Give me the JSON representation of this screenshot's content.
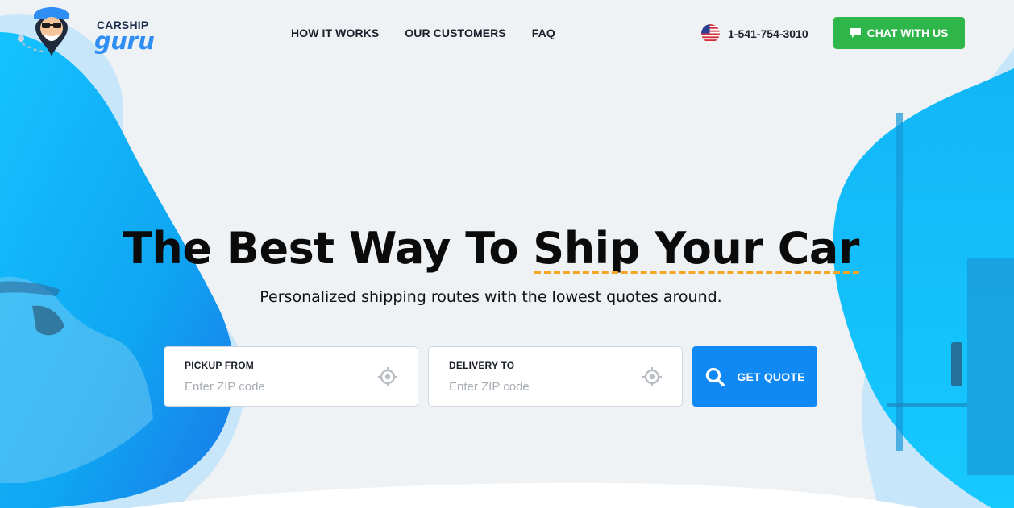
{
  "brand": {
    "name_top": "CARSHIP",
    "name_bottom": "guru"
  },
  "nav": {
    "items": [
      {
        "label": "HOW IT WORKS"
      },
      {
        "label": "OUR CUSTOMERS"
      },
      {
        "label": "FAQ"
      }
    ]
  },
  "contact": {
    "flag_icon": "us-flag-icon",
    "phone": "1-541-754-3010",
    "chat_label": "CHAT WITH US",
    "chat_icon": "chat-bubble-icon"
  },
  "hero": {
    "title_plain": "The Best Way To ",
    "title_highlight": "Ship Your Car",
    "subtitle": "Personalized shipping routes with the lowest quotes around."
  },
  "quote_form": {
    "pickup": {
      "label": "PICKUP FROM",
      "placeholder": "Enter ZIP code",
      "value": "",
      "icon": "crosshair-icon"
    },
    "delivery": {
      "label": "DELIVERY TO",
      "placeholder": "Enter ZIP code",
      "value": "",
      "icon": "crosshair-icon"
    },
    "submit_label": "GET QUOTE",
    "submit_icon": "search-icon"
  },
  "colors": {
    "accent_blue": "#1189f5",
    "chat_green": "#2fb64a",
    "highlight_orange": "#f5a623",
    "background": "#eef2f5"
  }
}
